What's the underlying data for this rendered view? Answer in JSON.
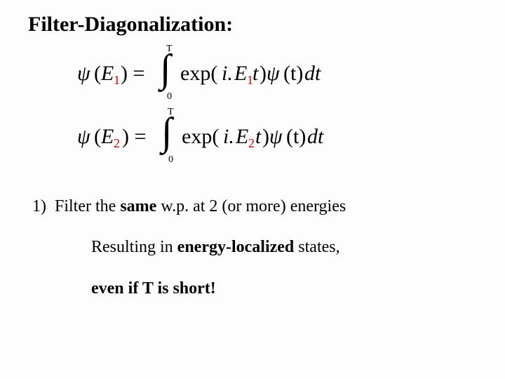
{
  "title": "Filter-Diagonalization:",
  "equations": {
    "limit_top": "T",
    "limit_bottom": "0",
    "eq1": {
      "psi": "ψ",
      "lpar": "(",
      "E": "E",
      "sub": "1",
      "rpar_eq": ") =",
      "int": "∫",
      "exp": "exp(",
      "i": "i.",
      "E2": "E",
      "sub2": "1",
      "t": "t",
      "close": ")",
      "psi2": "ψ",
      "tpar": "(t)",
      "dt": "dt"
    },
    "eq2": {
      "psi": "ψ",
      "lpar": "(",
      "E": "E",
      "sub": "2",
      "rpar_eq": ") =",
      "int": "∫",
      "exp": "exp(",
      "i": "i.",
      "E2": "E",
      "sub2": "2",
      "t": "t",
      "close": ")",
      "psi2": "ψ",
      "tpar": "(t)",
      "dt": "dt"
    }
  },
  "body": {
    "line1_no": "1)",
    "line1a": "Filter the ",
    "line1b": "same",
    "line1c": " w.p. at 2 (or more) energies",
    "line2a": "Resulting in ",
    "line2b": "energy-localized",
    "line2c": " states,",
    "line3a": "even if T is short!"
  }
}
